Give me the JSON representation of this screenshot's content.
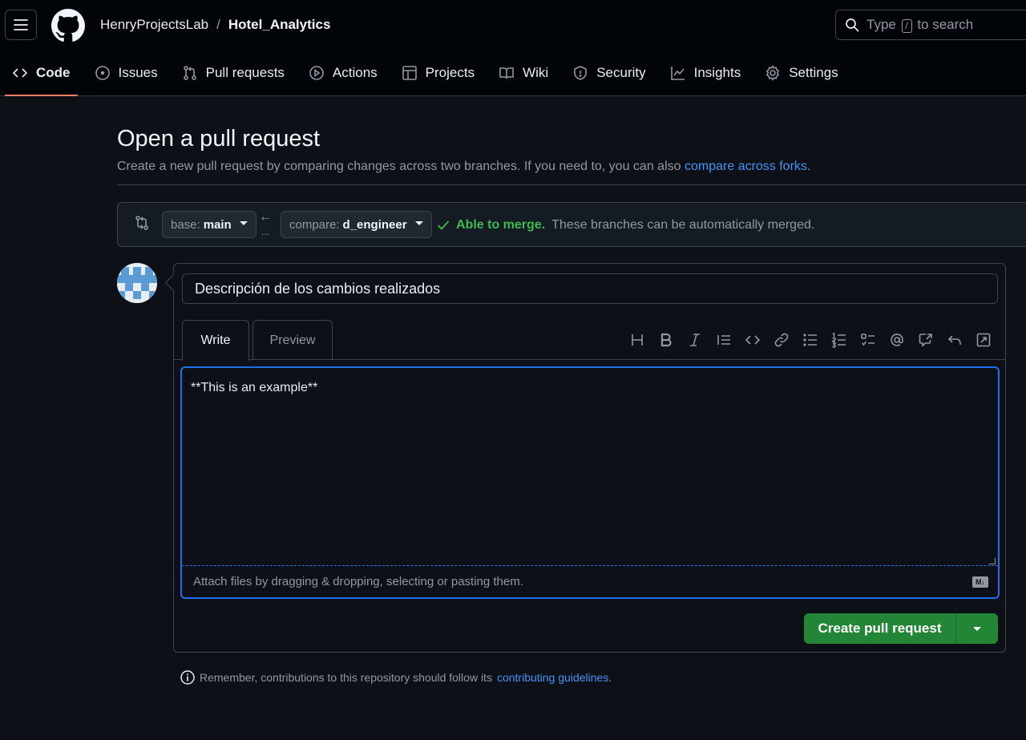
{
  "header": {
    "owner": "HenryProjectsLab",
    "separator": "/",
    "repo": "Hotel_Analytics",
    "search_prefix": "Type",
    "search_key": "/",
    "search_suffix": "to search"
  },
  "tabs": [
    {
      "label": "Code",
      "icon": "code-icon",
      "selected": true
    },
    {
      "label": "Issues",
      "icon": "issue-opened-icon"
    },
    {
      "label": "Pull requests",
      "icon": "git-pull-request-icon"
    },
    {
      "label": "Actions",
      "icon": "play-icon"
    },
    {
      "label": "Projects",
      "icon": "table-icon"
    },
    {
      "label": "Wiki",
      "icon": "book-icon"
    },
    {
      "label": "Security",
      "icon": "shield-icon"
    },
    {
      "label": "Insights",
      "icon": "graph-icon"
    },
    {
      "label": "Settings",
      "icon": "gear-icon"
    }
  ],
  "page": {
    "title": "Open a pull request",
    "subtitle": "Create a new pull request by comparing changes across two branches. If you need to, you can also",
    "subtitle_link": "compare across forks",
    "subtitle_end": "."
  },
  "range": {
    "base_prefix": "base:",
    "base_branch": "main",
    "compare_prefix": "compare:",
    "compare_branch": "d_engineer",
    "arrow": "←",
    "dots": "...",
    "merge_ok": "Able to merge.",
    "merge_text": "These branches can be automatically merged."
  },
  "form": {
    "title_value": "Descripción de los cambios realizados",
    "tab_write": "Write",
    "tab_preview": "Preview",
    "body_value": "**This is an example**",
    "attach_text": "Attach files by dragging & dropping, selecting or pasting them.",
    "markdown_badge": "M↓",
    "create_label": "Create pull request"
  },
  "toolbar": [
    "heading-icon",
    "bold-icon",
    "italic-icon",
    "quote-icon",
    "code-icon",
    "link-icon",
    "unordered-list-icon",
    "ordered-list-icon",
    "tasklist-icon",
    "mention-icon",
    "cross-reference-icon",
    "reply-icon",
    "fullscreen-icon"
  ],
  "footnote": {
    "text": "Remember, contributions to this repository should follow its",
    "link": "contributing guidelines",
    "end": "."
  },
  "colors": {
    "accent_link": "#4493f8",
    "success": "#3fb950",
    "primary_button": "#238636",
    "tab_underline": "#f78166",
    "focus": "#1f6feb"
  }
}
